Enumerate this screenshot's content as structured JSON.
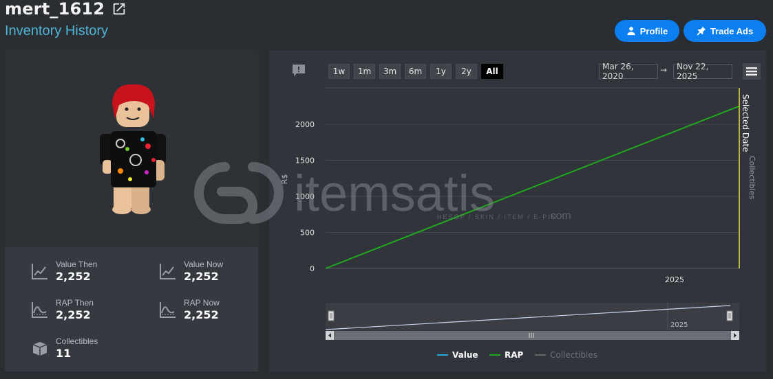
{
  "header": {
    "username": "mert_1612",
    "subtitle": "Inventory History",
    "profile_label": "Profile",
    "tradeads_label": "Trade Ads"
  },
  "stats": {
    "value_then_label": "Value Then",
    "value_then": "2,252",
    "value_now_label": "Value Now",
    "value_now": "2,252",
    "rap_then_label": "RAP Then",
    "rap_then": "2,252",
    "rap_now_label": "RAP Now",
    "rap_now": "2,252",
    "collectibles_label": "Collectibles",
    "collectibles": "11"
  },
  "chart_controls": {
    "ranges": [
      "1w",
      "1m",
      "3m",
      "6m",
      "1y",
      "2y",
      "All"
    ],
    "active_range": "All",
    "date_from": "Mar 26, 2020",
    "date_arrow": "→",
    "date_to": "Nov 22, 2025"
  },
  "watermark": {
    "brand": "itemsatis",
    "tagline": "HESOP / SKIN / ITEM / E-PIN",
    "suffix": ".com"
  },
  "colors": {
    "accent": "#0b7ff0",
    "rap": "#1fa81f",
    "value": "#29a9e0",
    "collectibles": "#666666",
    "selected": "#e8e23a"
  },
  "chart_data": {
    "type": "line",
    "ylabel": "R$",
    "yticks": [
      0,
      500,
      1000,
      1500,
      2000
    ],
    "ylim": [
      0,
      2252
    ],
    "xticks": [
      "2025"
    ],
    "x_start": "2020-03-26",
    "x_end": "2025-11-22",
    "series": [
      {
        "name": "Value",
        "values": [
          0,
          2252
        ],
        "color": "#29a9e0"
      },
      {
        "name": "RAP",
        "values": [
          0,
          2252
        ],
        "color": "#1fa81f"
      },
      {
        "name": "Collectibles",
        "values": [],
        "color": "#666666"
      }
    ],
    "annotation_main": "Selected Date",
    "annotation_side": "Collectibles",
    "navigator_tick": "2025"
  }
}
